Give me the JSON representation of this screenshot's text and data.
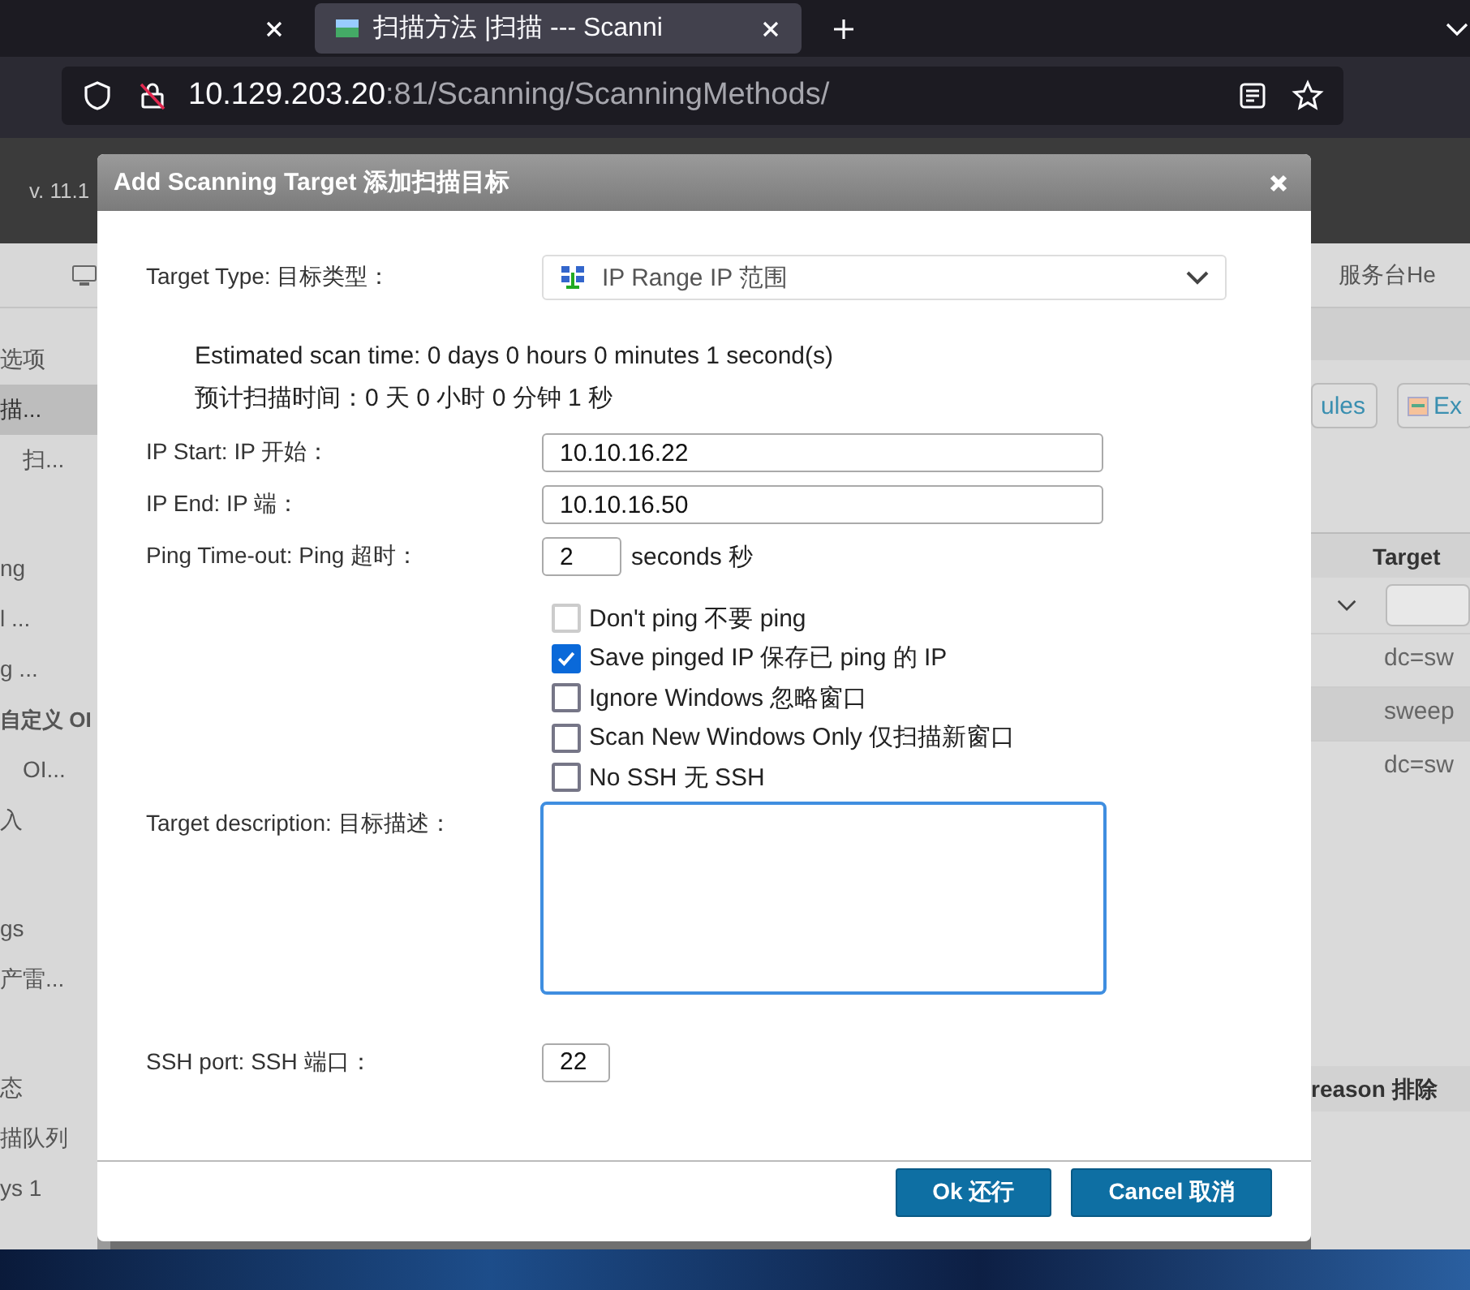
{
  "browser": {
    "tabs": [
      {
        "selected": false
      },
      {
        "title": "扫描方法 |扫描 --- Scanni",
        "selected": true
      }
    ],
    "address_bar": {
      "host": "10.129.203.20",
      "path": ":81/Scanning/ScanningMethods/"
    }
  },
  "app": {
    "version": "v. 11.1",
    "sidebar": {
      "groups": [
        {
          "items": [
            {
              "label": "选项",
              "selected": false
            },
            {
              "label": "描...",
              "selected": true,
              "children": [
                {
                  "label": "扫...",
                  "selected": false
                }
              ]
            }
          ]
        },
        {
          "items": [
            {
              "label": "ng",
              "selected": false
            },
            {
              "label": "l  ...",
              "selected": false
            },
            {
              "label": "g  ...",
              "selected": false
            },
            {
              "label": "自定义 OI",
              "selected": false,
              "kind": "heading",
              "children": [
                {
                  "label": "OI...",
                  "selected": false
                }
              ]
            },
            {
              "label": "入",
              "selected": false
            }
          ]
        },
        {
          "items": [
            {
              "label": "gs",
              "selected": false
            },
            {
              "label": "产雷...",
              "selected": false
            }
          ]
        },
        {
          "items": [
            {
              "label": "态",
              "selected": false
            },
            {
              "label": "描队列",
              "selected": false
            },
            {
              "label": "ys  1",
              "selected": false
            }
          ]
        }
      ]
    },
    "right_panel": {
      "header_link": "服务台He",
      "buttons": [
        "ules",
        "Ex"
      ],
      "table": {
        "column": "Target",
        "rows": [
          {
            "cell": "dc=sw",
            "selected": false
          },
          {
            "cell": "sweep",
            "selected": true
          },
          {
            "cell": "dc=sw",
            "selected": false
          }
        ]
      },
      "second_table": {
        "column": "reason  排除"
      }
    }
  },
  "dialog": {
    "title": "Add Scanning Target  添加扫描目标",
    "target_type": {
      "label": "Target Type:  目标类型：",
      "value": "IP Range  IP 范围"
    },
    "estimate": [
      "Estimated scan time: 0 days 0 hours 0 minutes 1 second(s)",
      "预计扫描时间：0 天 0 小时 0 分钟 1 秒"
    ],
    "fields": [
      {
        "label": "IP Start:  IP 开始：",
        "value": "10.10.16.22",
        "kind": "wide"
      },
      {
        "label": "IP End:  IP 端：",
        "value": "10.10.16.50",
        "kind": "wide"
      },
      {
        "label": "Ping Time-out:  Ping 超时：",
        "value": "2",
        "kind": "short",
        "unit": "seconds  秒"
      }
    ],
    "options": [
      {
        "label": "Don't ping  不要 ping",
        "checked": false,
        "disabled": true
      },
      {
        "label": "Save pinged IP  保存已 ping 的 IP",
        "checked": true,
        "disabled": false
      },
      {
        "label": "Ignore Windows  忽略窗口",
        "checked": false,
        "disabled": false
      },
      {
        "label": "Scan New Windows Only  仅扫描新窗口",
        "checked": false,
        "disabled": false
      },
      {
        "label": "No SSH  无 SSH",
        "checked": false,
        "disabled": false
      }
    ],
    "description": {
      "label": "Target description:  目标描述：",
      "focused": true
    },
    "ssh_port": {
      "label": "SSH port:  SSH 端口：",
      "value": "22"
    },
    "buttons": [
      {
        "label": "Ok  还行"
      },
      {
        "label": "Cancel  取消"
      }
    ]
  }
}
